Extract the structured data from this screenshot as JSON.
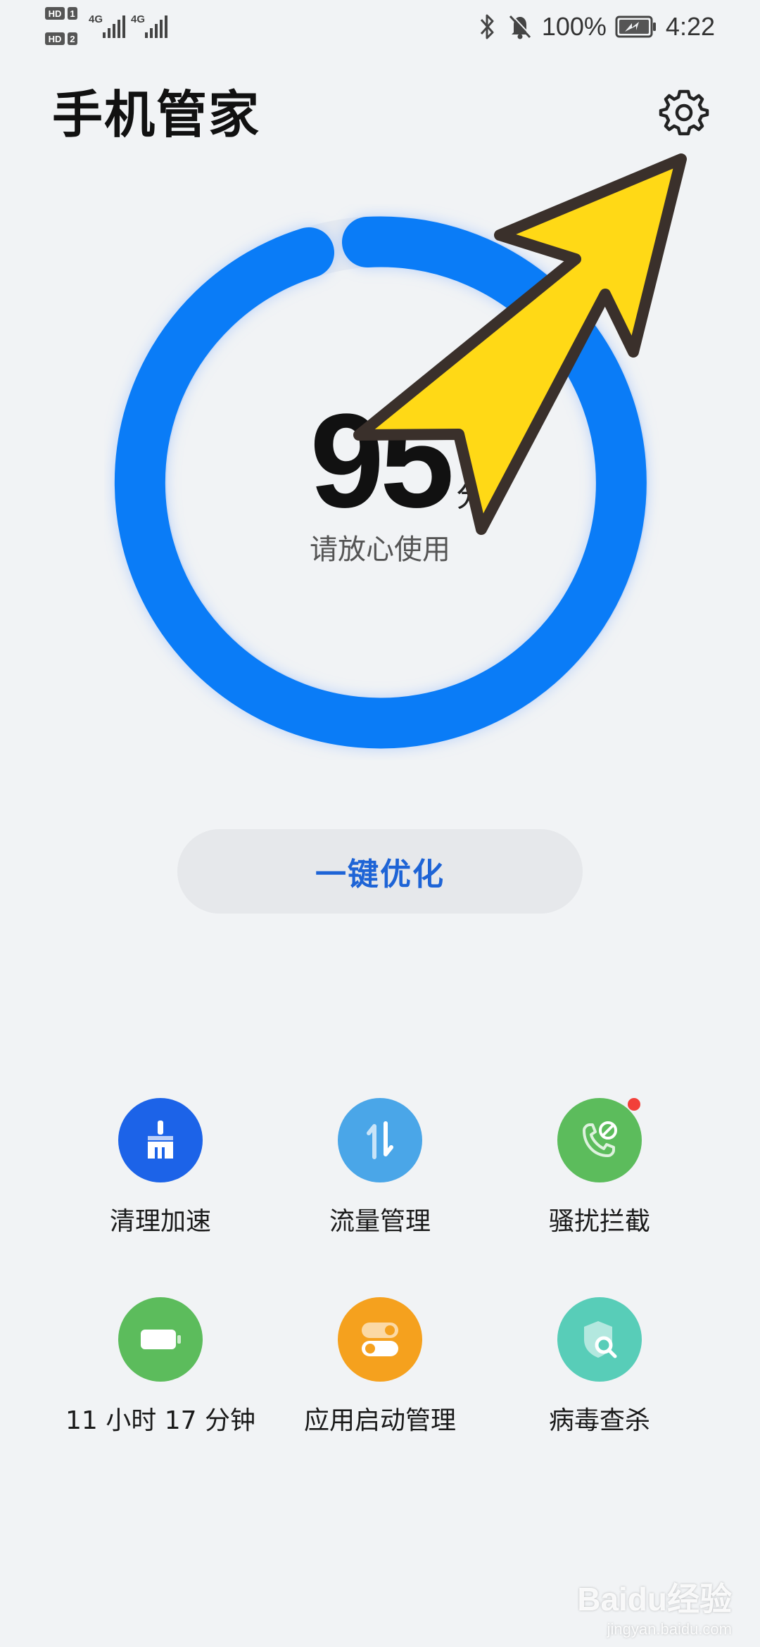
{
  "status_bar": {
    "sim1_label": "HD",
    "sim1_index": "1",
    "sim2_label": "HD",
    "sim2_index": "2",
    "network_1": "4G",
    "network_2": "4G",
    "battery_percent": "100%",
    "time": "4:22",
    "icons": [
      "bluetooth-icon",
      "mute-bell-icon",
      "battery-charging-icon"
    ]
  },
  "header": {
    "title": "手机管家",
    "settings_icon": "gear-icon"
  },
  "score": {
    "value": "95",
    "unit": "分",
    "status": "请放心使用",
    "ring_colors": [
      "#0a7cf7",
      "#3b86f2"
    ]
  },
  "optimize_button": {
    "label": "一键优化"
  },
  "tools": [
    {
      "label": "清理加速",
      "icon": "broom-icon",
      "color": "#1c63e8",
      "badge": false
    },
    {
      "label": "流量管理",
      "icon": "data-transfer-icon",
      "color": "#4aa6e8",
      "badge": false
    },
    {
      "label": "骚扰拦截",
      "icon": "blocked-call-icon",
      "color": "#5cbc5c",
      "badge": true
    },
    {
      "label": "11 小时 17 分钟",
      "icon": "battery-icon",
      "color": "#5cbc5c",
      "badge": false
    },
    {
      "label": "应用启动管理",
      "icon": "toggle-switch-icon",
      "color": "#f5a11e",
      "badge": false
    },
    {
      "label": "病毒查杀",
      "icon": "shield-search-icon",
      "color": "#58cdb8",
      "badge": false
    }
  ],
  "watermark": {
    "brand": "Baidu经验",
    "url": "jingyan.baidu.com"
  }
}
